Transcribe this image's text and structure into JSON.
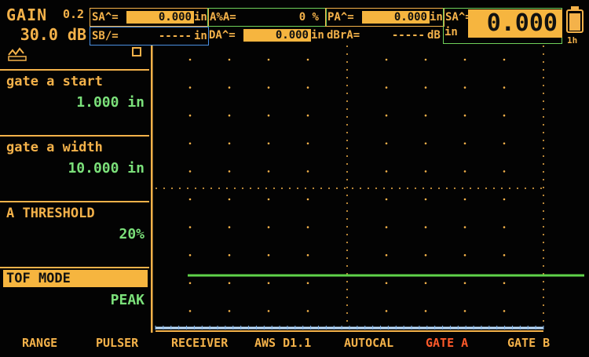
{
  "header": {
    "gain_label": "GAIN",
    "gain_step": "0.2",
    "gain_value": "30.0 dB",
    "readings_row1": [
      {
        "label": "SA^=",
        "value": "0.000",
        "unit": "in"
      },
      {
        "label": "A%A=",
        "value": "0 %",
        "unit": ""
      },
      {
        "label": "PA^=",
        "value": "0.000",
        "unit": "in"
      },
      {
        "label": "SA^=",
        "value": "",
        "unit": ""
      }
    ],
    "readings_row2": [
      {
        "label": "SB/=",
        "value": "-----",
        "unit": "in"
      },
      {
        "label": "DA^=",
        "value": "0.000",
        "unit": "in"
      },
      {
        "label": "dBrA=",
        "value": "-----",
        "unit": "dB"
      }
    ],
    "big_reading": {
      "value": "0.000",
      "unit": "in"
    },
    "battery_time": "1h"
  },
  "left_panel": {
    "params": [
      {
        "title": "gate a start",
        "value": "1.000 in"
      },
      {
        "title": "gate a width",
        "value": "10.000 in"
      },
      {
        "title": "A THRESHOLD",
        "value": "20%"
      },
      {
        "title": "TOF MODE",
        "value": "PEAK"
      }
    ]
  },
  "menu": [
    {
      "label": "RANGE",
      "active": false
    },
    {
      "label": "PULSER",
      "active": false
    },
    {
      "label": "RECEIVER",
      "active": false
    },
    {
      "label": "AWS D1.1",
      "active": false
    },
    {
      "label": "AUTOCAL",
      "active": false
    },
    {
      "label": "GATE A",
      "active": true
    },
    {
      "label": "GATE B",
      "active": false
    }
  ],
  "colors": {
    "accent": "#f6b53f",
    "value_green": "#7be07a",
    "gate_line": "#5fd24a",
    "active_menu": "#ff5a2a",
    "baseline_blue": "#bfe0ff"
  }
}
